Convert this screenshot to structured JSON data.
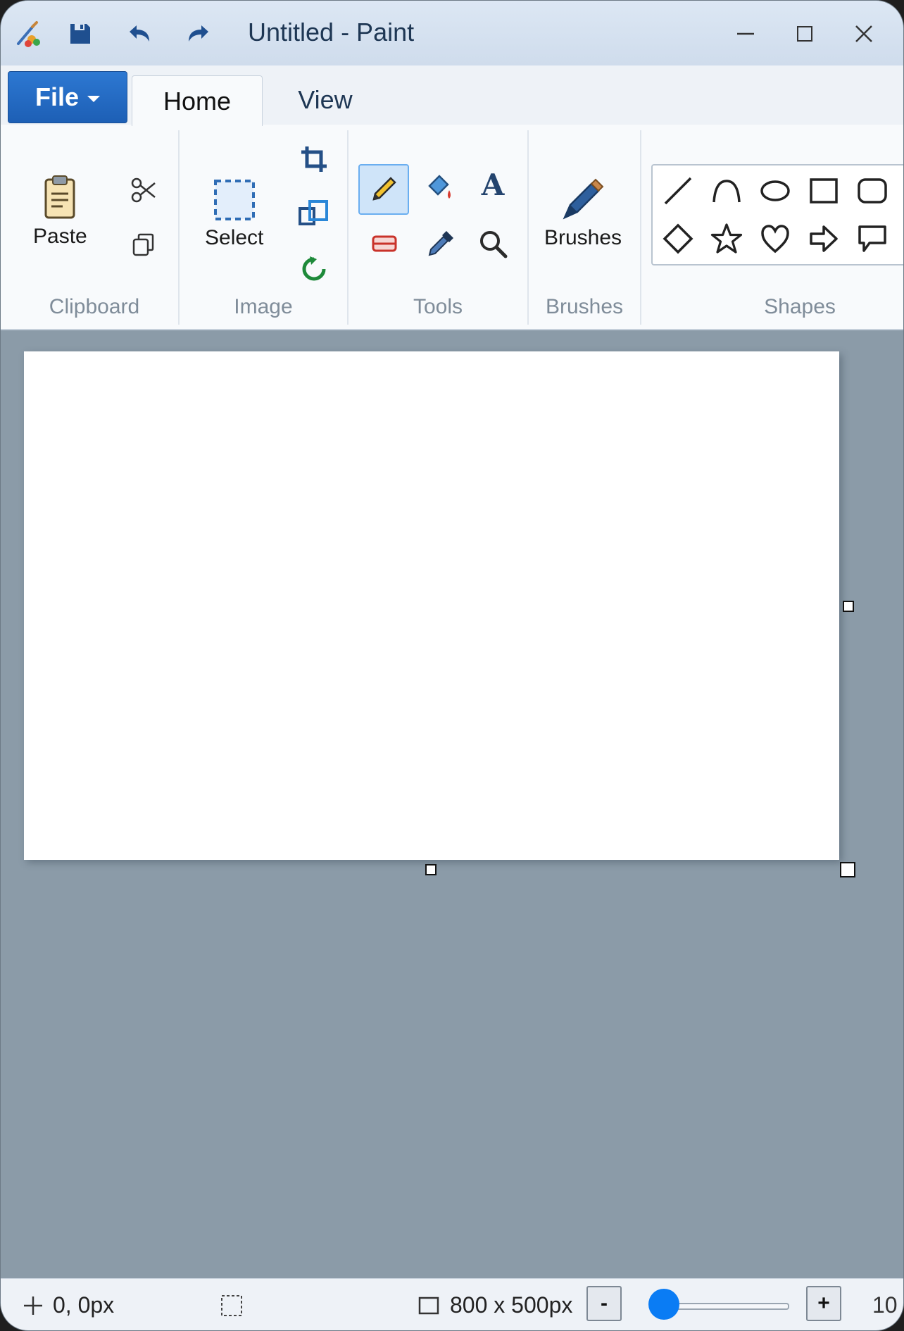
{
  "window": {
    "title": "Untitled - Paint"
  },
  "tabs": {
    "file": "File",
    "home": "Home",
    "view": "View",
    "active": "Home"
  },
  "ribbon": {
    "clipboard": {
      "group_label": "Clipboard",
      "paste_label": "Paste"
    },
    "image": {
      "group_label": "Image",
      "select_label": "Select"
    },
    "tools": {
      "group_label": "Tools",
      "text_glyph": "A",
      "selected": "pencil"
    },
    "brushes": {
      "group_label": "Brushes",
      "brushes_label": "Brushes"
    },
    "shapes": {
      "group_label": "Shapes",
      "items": [
        "line",
        "curve",
        "oval",
        "rectangle",
        "rounded-rectangle",
        "diamond",
        "star",
        "heart",
        "arrow",
        "callout"
      ]
    }
  },
  "status": {
    "cursor_position": "0, 0px",
    "canvas_size": "800 x 500px",
    "zoom_out_label": "-",
    "zoom_in_label": "+",
    "zoom_level_text": "10",
    "zoom_slider_fraction": 0.0
  },
  "colors": {
    "accent": "#1d5fb5",
    "workspace": "#8b9ba8",
    "selected_tool": "#cfe4f9",
    "slider_thumb": "#0a7cf4"
  }
}
